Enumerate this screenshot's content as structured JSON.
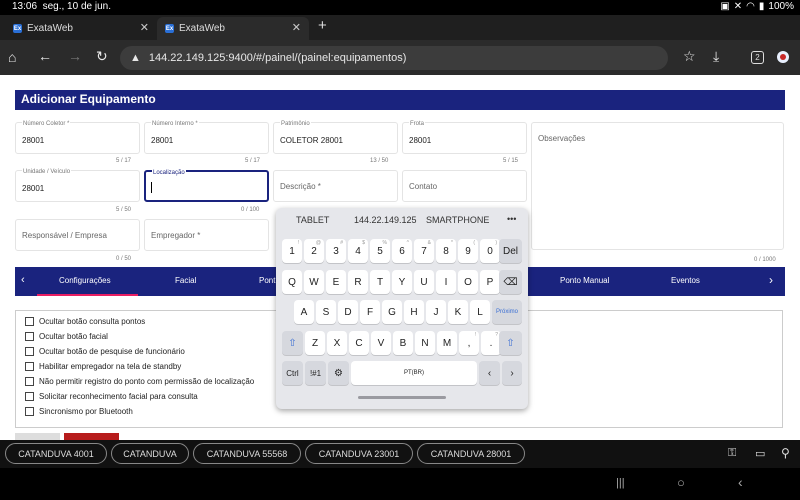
{
  "status": {
    "time": "13:06",
    "date": "seg., 10 de jun.",
    "battery": "100%"
  },
  "tabs": [
    {
      "label": "ExataWeb",
      "icon": "Ex"
    },
    {
      "label": "ExataWeb",
      "icon": "Ex"
    }
  ],
  "url": "144.22.149.125:9400/#/painel/(painel:equipamentos)",
  "toolbar": {
    "tab_count": "2"
  },
  "form": {
    "title": "Adicionar Equipamento",
    "numero_coletor": {
      "label": "Número Coletor *",
      "value": "28001",
      "count": "5 / 17"
    },
    "numero_interno": {
      "label": "Número Interno *",
      "value": "28001",
      "count": "5 / 17"
    },
    "patrimonio": {
      "label": "Patrimônio",
      "value": "COLETOR 28001",
      "count": "13 / 50"
    },
    "frota": {
      "label": "Frota",
      "value": "28001",
      "count": "5 / 15"
    },
    "observacoes": {
      "placeholder": "Observações",
      "count": "0 / 1000"
    },
    "unidade": {
      "label": "Unidade / Veículo",
      "value": "28001",
      "count": "5 / 50"
    },
    "localizacao": {
      "label": "Localização",
      "value": "",
      "count": "0 / 100"
    },
    "descricao": {
      "placeholder": "Descrição *"
    },
    "contato": {
      "placeholder": "Contato"
    },
    "responsavel": {
      "placeholder": "Responsável / Empresa",
      "count": "0 / 50"
    },
    "empregador": {
      "placeholder": "Empregador *"
    }
  },
  "subtabs": [
    "Configurações",
    "Facial",
    "Pont",
    "Ponto Manual",
    "Eventos"
  ],
  "options": [
    "Ocultar botão consulta pontos",
    "Ocultar botão facial",
    "Ocultar botão de pesquise de funcionário",
    "Habilitar empregador na tela de standby",
    "Não permitir registro do ponto com permissão de localização",
    "Solicitar reconhecimento facial para consulta",
    "Sincronismo por Bluetooth"
  ],
  "keyboard": {
    "suggestions": [
      "TABLET",
      "144.22.149.125",
      "SMARTPHONE",
      "•••"
    ],
    "row1": [
      "1",
      "2",
      "3",
      "4",
      "5",
      "6",
      "7",
      "8",
      "9",
      "0"
    ],
    "row1_hints": [
      "!",
      "@",
      "#",
      "$",
      "%",
      "^",
      "&",
      "*",
      "(",
      ")"
    ],
    "del": "Del",
    "row2": [
      "Q",
      "W",
      "E",
      "R",
      "T",
      "Y",
      "U",
      "I",
      "O",
      "P"
    ],
    "row3": [
      "A",
      "S",
      "D",
      "F",
      "G",
      "H",
      "J",
      "K",
      "L"
    ],
    "proximo": "Próximo",
    "row4": [
      "Z",
      "X",
      "C",
      "V",
      "B",
      "N",
      "M",
      ",",
      "."
    ],
    "row4_hints": [
      "",
      "",
      "",
      "",
      "",
      "",
      "",
      "!",
      "?"
    ],
    "ctrl": "Ctrl",
    "sym": "!#1",
    "space": "PT(BR)"
  },
  "chips": [
    "CATANDUVA 4001",
    "CATANDUVA",
    "CATANDUVA 55568",
    "CATANDUVA 23001",
    "CATANDUVA 28001"
  ],
  "colors": {
    "header": "#1a237e",
    "accent": "#e91e63"
  }
}
